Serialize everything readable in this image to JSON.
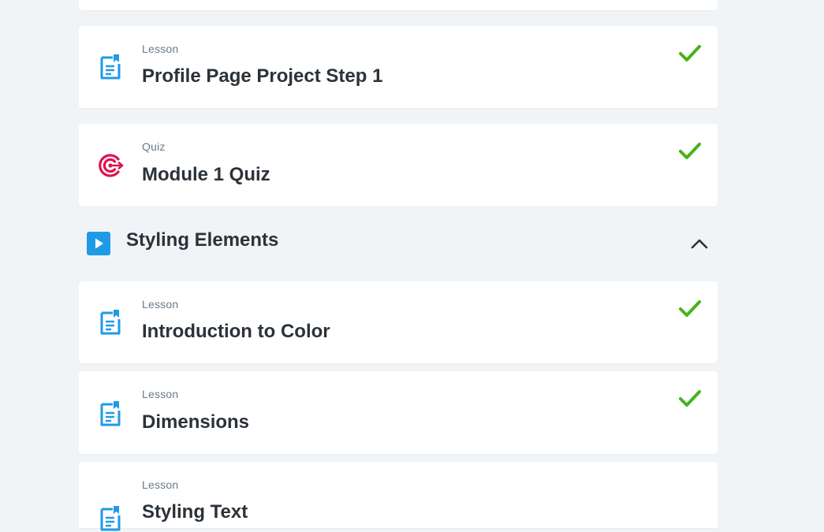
{
  "items": [
    {
      "type_label": "Lesson",
      "title": "Profile Page Project Step 1",
      "icon": "lesson-doc-icon",
      "completed": true
    },
    {
      "type_label": "Quiz",
      "title": "Module 1 Quiz",
      "icon": "quiz-target-icon",
      "completed": true
    }
  ],
  "section": {
    "title": "Styling Elements",
    "icon": "play-icon",
    "expanded": true,
    "items": [
      {
        "type_label": "Lesson",
        "title": "Introduction to Color",
        "icon": "lesson-doc-icon",
        "completed": true
      },
      {
        "type_label": "Lesson",
        "title": "Dimensions",
        "icon": "lesson-doc-icon",
        "completed": true
      },
      {
        "type_label": "Lesson",
        "title": "Styling Text",
        "icon": "lesson-doc-icon",
        "completed": false
      }
    ]
  },
  "colors": {
    "background": "#f1f4f7",
    "lesson_icon": "#1f9be6",
    "quiz_icon": "#e0144f",
    "check": "#47b21d",
    "play_icon": "#1f9be6",
    "title_text": "#2b3239",
    "type_text": "#6b7a89"
  }
}
